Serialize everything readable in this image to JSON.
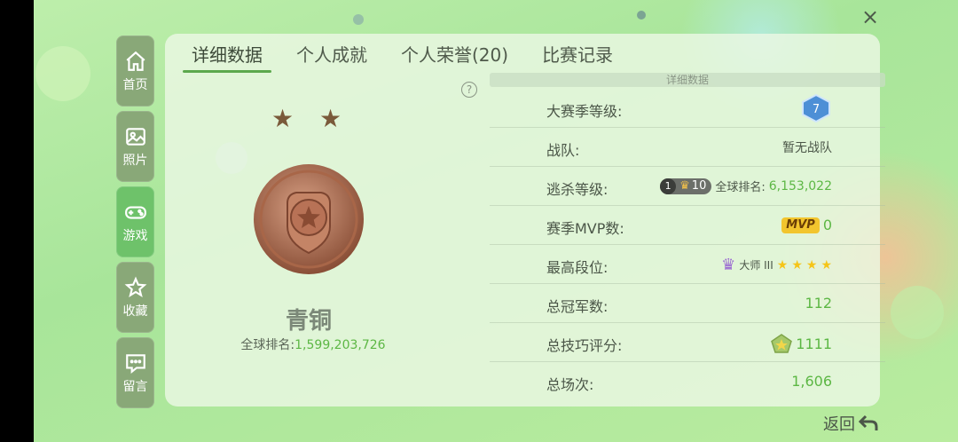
{
  "close_label": "×",
  "sidebar": {
    "items": [
      {
        "label": "首页",
        "icon": "home-icon"
      },
      {
        "label": "照片",
        "icon": "photo-icon"
      },
      {
        "label": "游戏",
        "icon": "gamepad-icon",
        "active": true
      },
      {
        "label": "收藏",
        "icon": "favorite-star-icon"
      },
      {
        "label": "留言",
        "icon": "message-icon"
      }
    ]
  },
  "tabs": [
    {
      "label": "详细数据",
      "active": true
    },
    {
      "label": "个人成就"
    },
    {
      "label": "个人荣誉(20)"
    },
    {
      "label": "比赛记录"
    }
  ],
  "help_label": "?",
  "rank": {
    "title": "青铜",
    "global_rank_label": "全球排名:",
    "global_rank_value": "1,599,203,726",
    "stars_count": 2
  },
  "details": {
    "header": "详细数据",
    "season_level": {
      "label": "大赛季等级:",
      "value": "7"
    },
    "team": {
      "label": "战队:",
      "value": "暂无战队"
    },
    "escape": {
      "label": "逃杀等级:",
      "badge_num": "1",
      "level": "10",
      "rank_label": "全球排名:",
      "rank_value": "6,153,022"
    },
    "mvp": {
      "label": "赛季MVP数:",
      "badge": "MVP",
      "value": "0"
    },
    "highest_tier": {
      "label": "最高段位:",
      "value": "大师 III",
      "stars": 4
    },
    "championships": {
      "label": "总冠军数:",
      "value": "112"
    },
    "skill_score": {
      "label": "总技巧评分:",
      "value": "1111"
    },
    "matches": {
      "label": "总场次:",
      "value": "1,606"
    }
  },
  "back_label": "返回",
  "colors": {
    "accent_green": "#5cb744",
    "active_tab": "#6ec26a",
    "sidebar": "#89a878"
  }
}
